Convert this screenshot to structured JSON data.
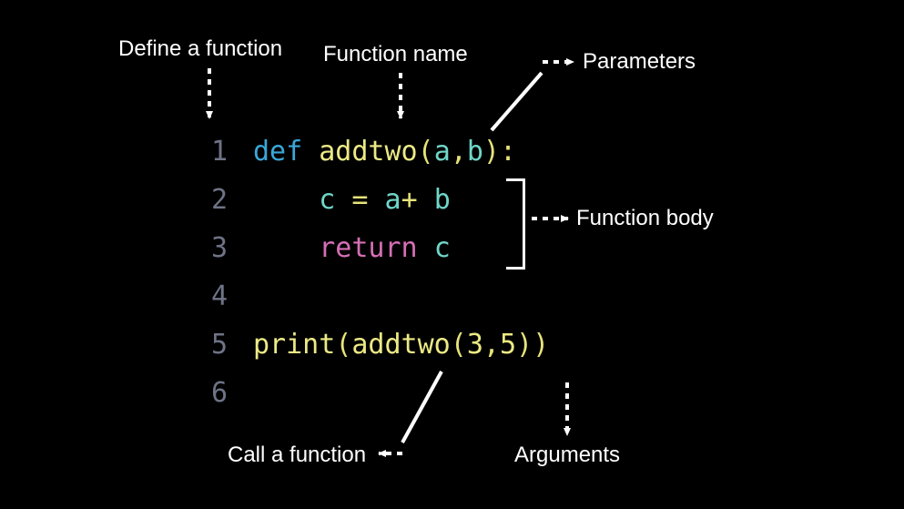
{
  "labels": {
    "define": "Define a function",
    "fname": "Function name",
    "parameters": "Parameters",
    "body": "Function body",
    "call": "Call a function",
    "arguments": "Arguments"
  },
  "code": {
    "lines": [
      {
        "n": "1",
        "tokens": [
          {
            "cls": "kw-def",
            "text": "def "
          },
          {
            "cls": "fn-name",
            "text": "addtwo"
          },
          {
            "cls": "paren",
            "text": "("
          },
          {
            "cls": "param",
            "text": "a"
          },
          {
            "cls": "paren",
            "text": ","
          },
          {
            "cls": "param",
            "text": "b"
          },
          {
            "cls": "paren",
            "text": ")"
          },
          {
            "cls": "colon",
            "text": ":"
          }
        ]
      },
      {
        "n": "2",
        "tokens": [
          {
            "cls": "",
            "text": "    "
          },
          {
            "cls": "var",
            "text": "c"
          },
          {
            "cls": "op",
            "text": " = "
          },
          {
            "cls": "var",
            "text": "a"
          },
          {
            "cls": "op",
            "text": "+ "
          },
          {
            "cls": "var",
            "text": "b"
          }
        ]
      },
      {
        "n": "3",
        "tokens": [
          {
            "cls": "",
            "text": "    "
          },
          {
            "cls": "kw-return",
            "text": "return "
          },
          {
            "cls": "var",
            "text": "c"
          }
        ]
      },
      {
        "n": "4",
        "tokens": []
      },
      {
        "n": "5",
        "tokens": [
          {
            "cls": "call",
            "text": "print"
          },
          {
            "cls": "paren",
            "text": "("
          },
          {
            "cls": "call",
            "text": "addtwo"
          },
          {
            "cls": "paren",
            "text": "("
          },
          {
            "cls": "num",
            "text": "3"
          },
          {
            "cls": "paren",
            "text": ","
          },
          {
            "cls": "num",
            "text": "5"
          },
          {
            "cls": "paren",
            "text": ")"
          },
          {
            "cls": "paren",
            "text": ")"
          }
        ]
      },
      {
        "n": "6",
        "tokens": []
      }
    ]
  }
}
